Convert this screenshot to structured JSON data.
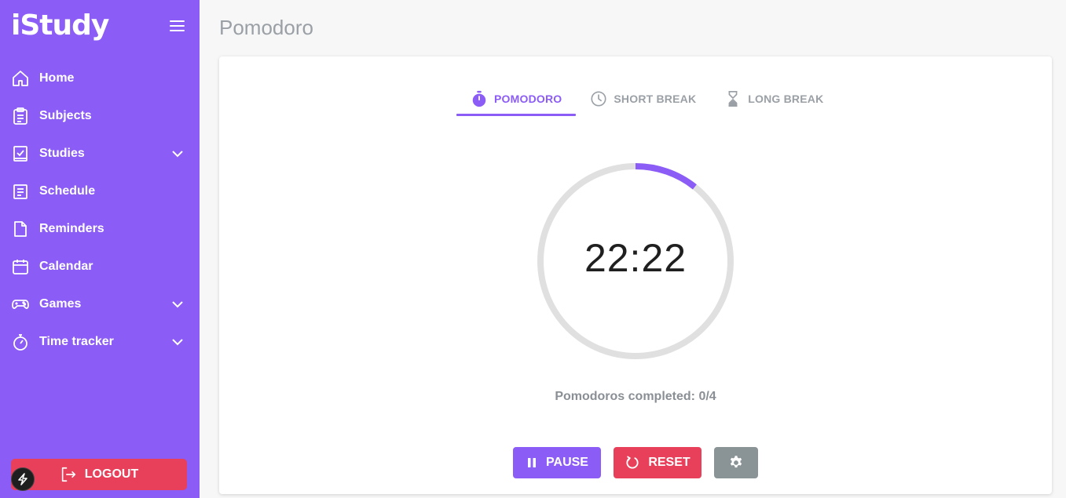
{
  "app": {
    "logo": "iStudy"
  },
  "sidebar": {
    "items": [
      {
        "label": "Home",
        "icon": "home-icon"
      },
      {
        "label": "Subjects",
        "icon": "clipboard-icon"
      },
      {
        "label": "Studies",
        "icon": "checkbook-icon",
        "expandable": true
      },
      {
        "label": "Schedule",
        "icon": "schedule-icon"
      },
      {
        "label": "Reminders",
        "icon": "note-icon"
      },
      {
        "label": "Calendar",
        "icon": "calendar-icon"
      },
      {
        "label": "Games",
        "icon": "gamepad-icon",
        "expandable": true
      },
      {
        "label": "Time tracker",
        "icon": "stopwatch-icon",
        "expandable": true
      }
    ],
    "logout_label": "LOGOUT"
  },
  "page": {
    "title": "Pomodoro"
  },
  "tabs": [
    {
      "label": "POMODORO",
      "icon": "timer-icon",
      "active": true
    },
    {
      "label": "SHORT BREAK",
      "icon": "clock-icon",
      "active": false
    },
    {
      "label": "LONG BREAK",
      "icon": "hourglass-icon",
      "active": false
    }
  ],
  "timer": {
    "display": "22:22",
    "progress_fraction": 0.107,
    "completed_text": "Pomodoros completed: 0/4"
  },
  "buttons": {
    "pause_label": "PAUSE",
    "reset_label": "RESET",
    "settings_icon": "gear-icon"
  },
  "colors": {
    "accent": "#8b5cf6",
    "danger": "#e8405a",
    "neutral": "#8a9396"
  }
}
